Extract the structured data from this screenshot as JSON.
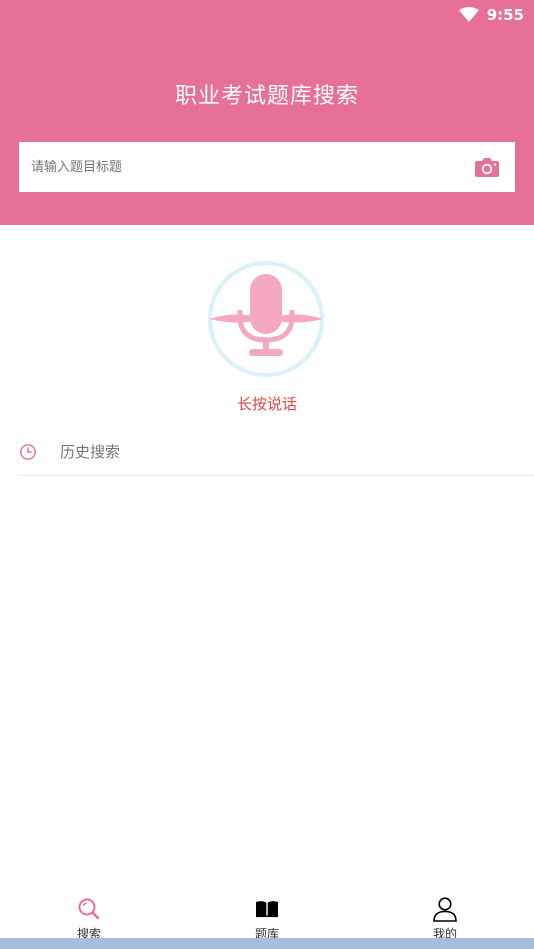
{
  "status_bar": {
    "time": "9:55",
    "wifi_icon": "wifi-icon"
  },
  "header": {
    "title": "职业考试题库搜索",
    "search": {
      "placeholder": "请输入题目标题",
      "value": "",
      "camera_icon": "camera-icon"
    }
  },
  "voice": {
    "icon": "microphone-icon",
    "label": "长按说话"
  },
  "history": {
    "icon": "clock-icon",
    "label": "历史搜索"
  },
  "bottom_nav": {
    "items": [
      {
        "label": "搜索",
        "icon": "search-icon",
        "active": true
      },
      {
        "label": "题库",
        "icon": "book-icon",
        "active": false
      },
      {
        "label": "我的",
        "icon": "user-icon",
        "active": false
      }
    ]
  },
  "colors": {
    "primary": "#e77097",
    "accent_red": "#e0463e",
    "mic_pink": "#f4a9c0",
    "ring_blue": "#d8f1fb",
    "nav_strip": "#a7bedb"
  }
}
